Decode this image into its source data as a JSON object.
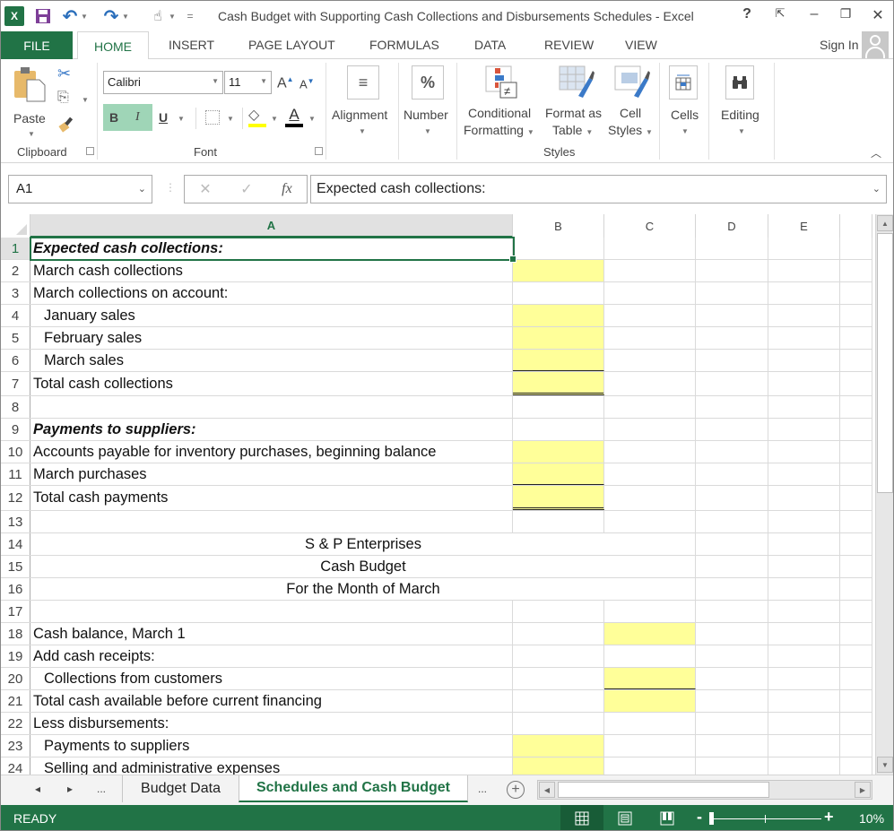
{
  "window": {
    "title": "Cash Budget with Supporting Cash Collections and Disbursements Schedules - Excel",
    "help": "?",
    "ribbon_display": "⇱",
    "minimize": "–",
    "restore": "❐",
    "close": "✕"
  },
  "quick_access": {
    "app_icon": "X",
    "save": "💾",
    "undo": "↶",
    "redo": "↷",
    "touch": "☝",
    "customize": "="
  },
  "tabs": {
    "file": "FILE",
    "items": [
      "HOME",
      "INSERT",
      "PAGE LAYOUT",
      "FORMULAS",
      "DATA",
      "REVIEW",
      "VIEW"
    ],
    "active": "HOME",
    "sign_in": "Sign In"
  },
  "ribbon": {
    "clipboard": {
      "paste": "Paste",
      "label": "Clipboard"
    },
    "font": {
      "name": "Calibri",
      "size": "11",
      "grow": "A",
      "shrink": "A",
      "bold": "B",
      "italic": "I",
      "underline": "U",
      "font_color": "A",
      "label": "Font",
      "highlight_color": "#ffff00",
      "text_color": "#000000"
    },
    "alignment": {
      "label": "Alignment",
      "icon": "≡"
    },
    "number": {
      "label": "Number",
      "icon": "%"
    },
    "styles": {
      "conditional_1": "Conditional",
      "conditional_2": "Formatting",
      "format_table_1": "Format as",
      "format_table_2": "Table",
      "cell_styles_1": "Cell",
      "cell_styles_2": "Styles",
      "label": "Styles"
    },
    "cells": {
      "label": "Cells"
    },
    "editing": {
      "label": "Editing"
    }
  },
  "formula_bar": {
    "name_box": "A1",
    "cancel": "✕",
    "enter": "✓",
    "fx": "fx",
    "content": "Expected cash collections:"
  },
  "columns": [
    "A",
    "B",
    "C",
    "D",
    "E"
  ],
  "selected_cell": "A1",
  "rows": [
    {
      "n": "1",
      "a": "Expected cash collections:",
      "style": "bi"
    },
    {
      "n": "2",
      "a": "March cash collections"
    },
    {
      "n": "3",
      "a": "March collections on account:"
    },
    {
      "n": "4",
      "a": "January sales",
      "indent": true
    },
    {
      "n": "5",
      "a": "February sales",
      "indent": true
    },
    {
      "n": "6",
      "a": "March sales",
      "indent": true
    },
    {
      "n": "7",
      "a": "Total cash collections"
    },
    {
      "n": "8",
      "a": ""
    },
    {
      "n": "9",
      "a": "Payments to suppliers:",
      "style": "bi"
    },
    {
      "n": "10",
      "a": "Accounts payable for inventory purchases, beginning balance"
    },
    {
      "n": "11",
      "a": "March purchases"
    },
    {
      "n": "12",
      "a": "Total cash payments"
    },
    {
      "n": "13",
      "a": ""
    },
    {
      "n": "14",
      "a": "S & P Enterprises",
      "center": true
    },
    {
      "n": "15",
      "a": "Cash Budget",
      "center": true
    },
    {
      "n": "16",
      "a": "For the Month of March",
      "center": true
    },
    {
      "n": "17",
      "a": ""
    },
    {
      "n": "18",
      "a": "Cash balance, March 1"
    },
    {
      "n": "19",
      "a": "Add cash receipts:"
    },
    {
      "n": "20",
      "a": "Collections from customers",
      "indent": true
    },
    {
      "n": "21",
      "a": "Total cash available before current financing"
    },
    {
      "n": "22",
      "a": "Less disbursements:"
    },
    {
      "n": "23",
      "a": "Payments to suppliers",
      "indent": true
    },
    {
      "n": "24",
      "a": "Selling and administrative expenses",
      "indent": true
    }
  ],
  "input_cell_color": "#ffff99",
  "sheets": {
    "nav_prev": "◂",
    "nav_next": "▸",
    "more_left": "...",
    "tabs": [
      "Budget Data",
      "Schedules and Cash Budget"
    ],
    "active": "Schedules and Cash Budget",
    "more_right": "...",
    "add": "+"
  },
  "status": {
    "mode": "READY",
    "zoom_minus": "-",
    "zoom_plus": "+",
    "zoom": "10%"
  },
  "accent_color": "#217346"
}
